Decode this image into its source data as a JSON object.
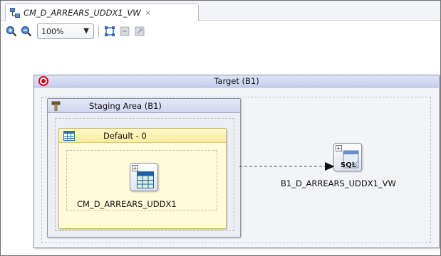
{
  "tab": {
    "title": "CM_D_ARREARS_UDDX1_VW",
    "close": "×"
  },
  "toolbar": {
    "zoom": "100%"
  },
  "canvas": {
    "target": {
      "title": "Target (B1)"
    },
    "staging": {
      "title": "Staging Area (B1)"
    },
    "dataset": {
      "title": "Default - 0"
    },
    "source_node": {
      "label": "CM_D_ARREARS_UDDX1"
    },
    "target_node": {
      "label": "B1_D_ARREARS_UDDX1_VW",
      "badge": "SQL"
    }
  },
  "colors": {
    "target_header": "#c7cff0",
    "dataset_body": "#fffbd9",
    "target_icon": "#d9001b"
  }
}
